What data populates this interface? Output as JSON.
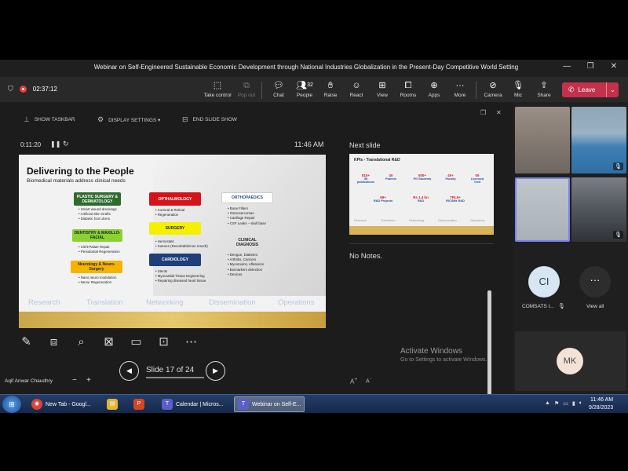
{
  "window": {
    "title": "Webinar on Self-Engineered Sustainable Economic Development through National Industries Globalization in the Present-Day Competitive World Setting",
    "min_icon": "minimize-icon",
    "max_icon": "restore-icon",
    "close_icon": "close-icon"
  },
  "toolbar": {
    "timer": "02:37:12",
    "take_control": "Take control",
    "pop_out": "Pop out",
    "chat": "Chat",
    "people_count": "32",
    "people": "People",
    "raise": "Raise",
    "react": "React",
    "view": "View",
    "rooms": "Rooms",
    "apps": "Apps",
    "more": "More",
    "camera": "Camera",
    "mic": "Mic",
    "share": "Share",
    "leave": "Leave"
  },
  "presenter": {
    "show_taskbar": "SHOW TASKBAR",
    "display_settings": "DISPLAY SETTINGS ▾",
    "end_slide_show": "END SLIDE SHOW",
    "elapsed": "0:11:20",
    "clock": "11:46 AM",
    "next_slide": "Next slide",
    "no_notes": "No Notes.",
    "slide_counter": "Slide 17 of 24",
    "presenter_name": "Aqif Anwar Chaudhry"
  },
  "slide": {
    "title": "Delivering to the People",
    "subtitle": "Biomedical materials address clinical needs",
    "boxes": {
      "plastic": "PLASTIC SURGERY & DERMATOLOGY",
      "dentistry": "DENTISTRY & MAXILLO-FACIAL",
      "neuro": "Neurology & Neuro-Surgery",
      "opthal": "OPTHALMOLOGY",
      "surgery": "SURGERY",
      "cardio": "CARDIOLOGY",
      "ortho": "ORTHOPAEDICS",
      "clinical": "CLINICAL DIAGNOSIS"
    },
    "bullets": {
      "plastic": [
        "Smart wound dressings",
        "Artificial Skin Grafts",
        "Diabetic foot ulcers"
      ],
      "dentistry": [
        "Cleft-Palate Repair",
        "Periodontal Regeneration"
      ],
      "neuro": [
        "Nano neuro modulation",
        "Nerve Regeneration"
      ],
      "opthal": [
        "Corneal & Retinal",
        "Regeneration"
      ],
      "surgery": [
        "Hemostats",
        "Sutures (Resorbable/non resorb)"
      ],
      "cardio": [
        "Stents",
        "Myocardial Tissue Engineering",
        "Repairing diseased heart tissue"
      ],
      "ortho": [
        "Bone Fillers",
        "Osteosarcomas",
        "Cartilage Repair",
        "CSF Leaks – skull base"
      ],
      "clinical": [
        "Dengue, Diabetes",
        "Arthritis, Cancers",
        "Mycotoxins, Aflatoxins",
        "Biomarkers detection",
        "Devices"
      ]
    },
    "pillars": [
      "Research",
      "Translation",
      "Networking",
      "Dissemination",
      "Operations"
    ]
  },
  "next_slide": {
    "title": "KPIs - Translational R&D",
    "stats": [
      {
        "value": "815+",
        "label": "ISI publications"
      },
      {
        "value": "40",
        "label": "Patents"
      },
      {
        "value": "500+",
        "label": "PG Students"
      },
      {
        "value": "40+",
        "label": "Faculty"
      },
      {
        "value": "05",
        "label": "Licensed Tech"
      },
      {
        "value": "69+",
        "label": "R&D Projects"
      },
      {
        "value": "Rs 1.4 bn",
        "label": "R&D"
      },
      {
        "value": "TRL5+",
        "label": "IRCSMs R&D"
      }
    ],
    "pillars": [
      "Research",
      "Translation",
      "Networking",
      "Dissemination",
      "Operations"
    ]
  },
  "roster": {
    "ci_initials": "CI",
    "ci_name": "COMSATS I...",
    "view_all": "View all",
    "mk_initials": "MK"
  },
  "activate": {
    "line1": "Activate Windows",
    "line2": "Go to Settings to activate Windows."
  },
  "taskbar": {
    "apps": [
      {
        "label": "New Tab - Googl..."
      },
      {
        "label": ""
      },
      {
        "label": ""
      },
      {
        "label": "Calendar | Micros..."
      },
      {
        "label": "Webinar on Self-E..."
      }
    ],
    "time": "11:46 AM",
    "date": "9/28/2023"
  },
  "colors": {
    "leave": "#c4314b",
    "accent": "#7b83eb",
    "plastic_box": "#2e6b2e",
    "dentistry_box": "#8bd12f",
    "neuro_box": "#f5b400",
    "opthal_box": "#d4141a",
    "surgery_box": "#f5f000",
    "cardio_box": "#1f3e7a"
  }
}
